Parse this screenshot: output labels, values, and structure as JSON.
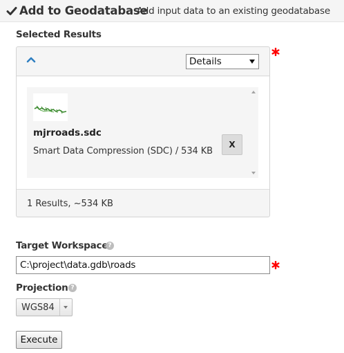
{
  "header": {
    "title": "Add to Geodatabase",
    "description": "Add input data to an existing geodatabase",
    "icon": "checkmark-icon"
  },
  "selected_results": {
    "label": "Selected Results",
    "required_icon": "required-asterisk-icon",
    "collapse_icon": "chevron-up-icon",
    "view_select": {
      "selected": "Details"
    },
    "items": [
      {
        "name": "mjrroads.sdc",
        "description": "Smart Data Compression (SDC) / 534 KB",
        "thumbnail_icon": "road-map-thumbnail",
        "remove_label": "X"
      }
    ],
    "summary": "1 Results, ~534 KB"
  },
  "target_workspace": {
    "label": "Target Workspace",
    "help_icon": "question-icon",
    "value": "C:\\project\\data.gdb\\roads"
  },
  "projection": {
    "label": "Projection",
    "help_icon": "question-icon",
    "selected": "WGS84"
  },
  "execute_label": "Execute",
  "colors": {
    "accent_blue": "#2f7fc1",
    "required_red": "#ff0000",
    "map_green": "#3b8a2e"
  }
}
